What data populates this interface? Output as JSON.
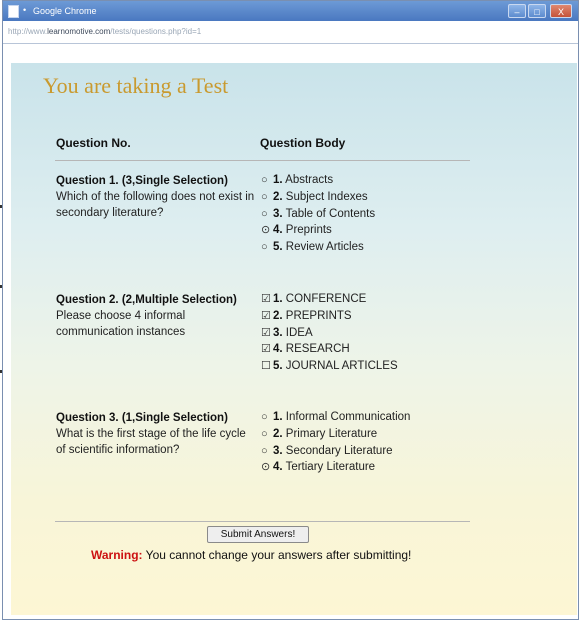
{
  "browser": {
    "title": "Google Chrome",
    "title_dot": "•",
    "url_prefix": "http://www.",
    "url_domain": "learnomotive.com",
    "url_path": "/tests/questions.php?id=1",
    "min_glyph": "–",
    "max_glyph": "□",
    "close_glyph": "X"
  },
  "page": {
    "title": "You are taking a Test",
    "col_question_no": "Question No.",
    "col_question_body": "Question Body"
  },
  "questions": [
    {
      "header": "Question 1. (3,Single Selection)",
      "text": "Which of the following does not exist in secondary literature?",
      "options": [
        {
          "num": "1.",
          "label": " Abstracts",
          "mark": "○"
        },
        {
          "num": "2.",
          "label": " Subject Indexes",
          "mark": "○"
        },
        {
          "num": "3.",
          "label": " Table of Contents",
          "mark": "○"
        },
        {
          "num": "4.",
          "label": " Preprints",
          "mark": "⊙"
        },
        {
          "num": "5.",
          "label": " Review Articles",
          "mark": "○"
        }
      ]
    },
    {
      "header": "Question 2. (2,Multiple Selection)",
      "text": "Please choose 4 informal communication instances",
      "options": [
        {
          "num": "1.",
          "label": " CONFERENCE",
          "mark": "☑"
        },
        {
          "num": "2.",
          "label": " PREPRINTS",
          "mark": "☑"
        },
        {
          "num": "3.",
          "label": " IDEA",
          "mark": "☑"
        },
        {
          "num": "4.",
          "label": " RESEARCH",
          "mark": "☑"
        },
        {
          "num": "5.",
          "label": " JOURNAL ARTICLES",
          "mark": "☐"
        }
      ]
    },
    {
      "header": "Question 3. (1,Single Selection)",
      "text": "What is the first stage of the life cycle of scientific information?",
      "options": [
        {
          "num": "1.",
          "label": " Informal Communication",
          "mark": "○"
        },
        {
          "num": "2.",
          "label": " Primary Literature",
          "mark": "○"
        },
        {
          "num": "3.",
          "label": " Secondary Literature",
          "mark": "○"
        },
        {
          "num": "4.",
          "label": " Tertiary Literature",
          "mark": "⊙"
        }
      ]
    }
  ],
  "footer": {
    "submit_label": "Submit Answers!",
    "warning_label": "Warning:",
    "warning_text": " You cannot change your answers after submitting!"
  }
}
